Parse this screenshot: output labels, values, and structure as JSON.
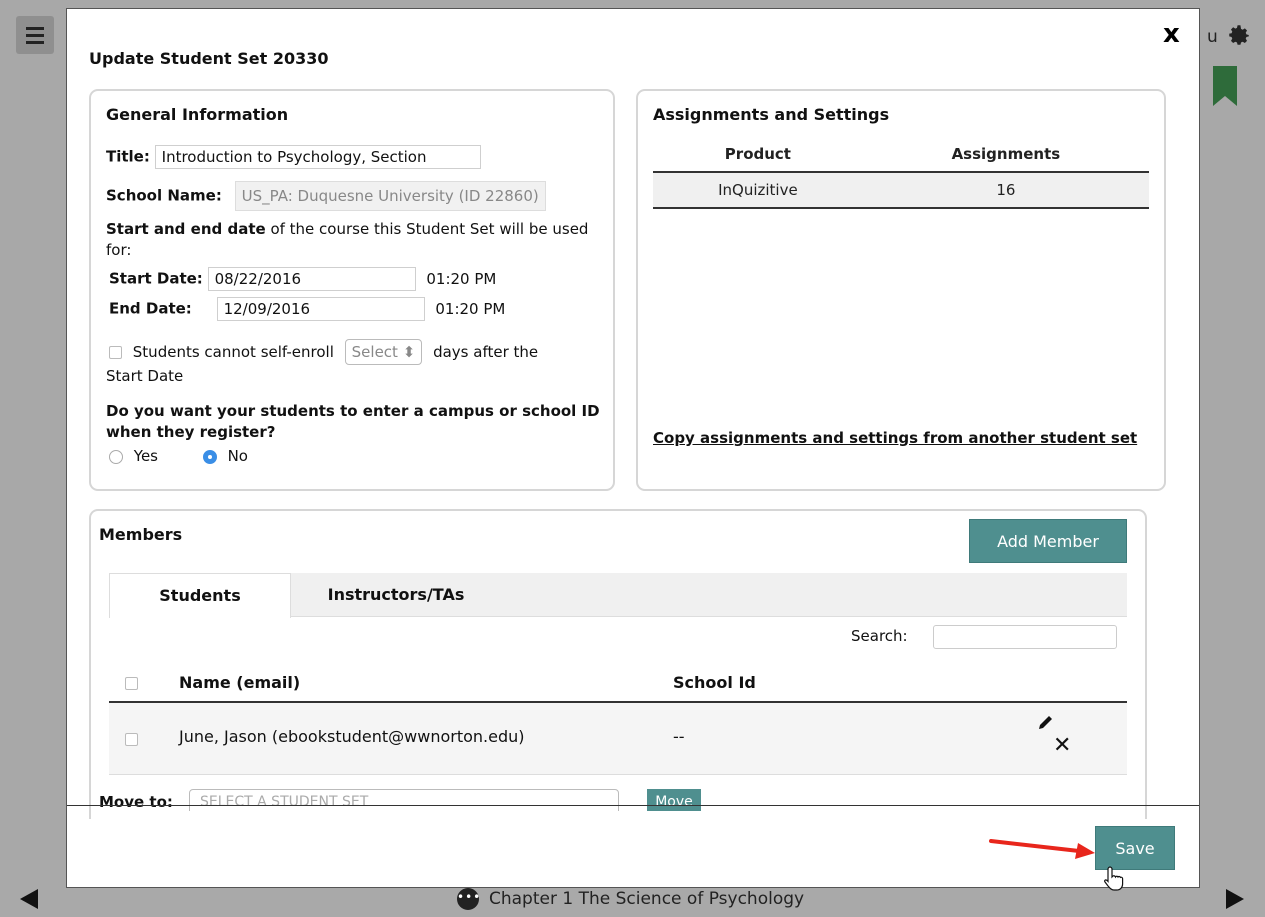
{
  "background": {
    "user_partial": "u",
    "chapter_title": "Chapter 1 The Science of Psychology",
    "chapter_icon": "more-dots-icon"
  },
  "modal": {
    "title": "Update Student Set 20330",
    "close_label": "x",
    "general": {
      "heading": "General Information",
      "title_label": "Title:",
      "title_value": "Introduction to Psychology, Section",
      "school_label": "School Name:",
      "school_value": "US_PA: Duquesne University (ID 22860)",
      "dates_intro_bold": "Start and end date",
      "dates_intro_rest": " of the course this Student Set will be used for:",
      "start_label": "Start Date:",
      "start_value": "08/22/2016",
      "start_time": "01:20 PM",
      "end_label": "End Date:",
      "end_value": "12/09/2016",
      "end_time": "01:20 PM",
      "self_enroll_label": "Students cannot self-enroll",
      "self_enroll_select": "Select",
      "self_enroll_after": "days after the",
      "self_enroll_after2": "Start Date",
      "campus_question": "Do you want your students to enter a campus or school ID when they register?",
      "yes_label": "Yes",
      "no_label": "No"
    },
    "assignments": {
      "heading": "Assignments and Settings",
      "columns": [
        "Product",
        "Assignments"
      ],
      "rows": [
        [
          "InQuizitive",
          "16"
        ]
      ],
      "copy_link": "Copy assignments and settings from another student set"
    },
    "members": {
      "heading": "Members",
      "add_button": "Add Member",
      "tabs": [
        "Students",
        "Instructors/TAs"
      ],
      "search_label": "Search:",
      "columns": [
        "Name (email)",
        "School Id"
      ],
      "rows": [
        {
          "name": "June, Jason (ebookstudent@wwnorton.edu)",
          "school_id": "--"
        }
      ],
      "move_to_label": "Move to:",
      "move_to_placeholder": "SELECT A STUDENT SET",
      "move_button": "Move"
    },
    "save_button": "Save"
  },
  "colors": {
    "accent": "#4f8f8f",
    "bookmark": "#2e6b3a",
    "annotation_arrow": "#e8261c",
    "radio_selected": "#3a8ee6"
  }
}
